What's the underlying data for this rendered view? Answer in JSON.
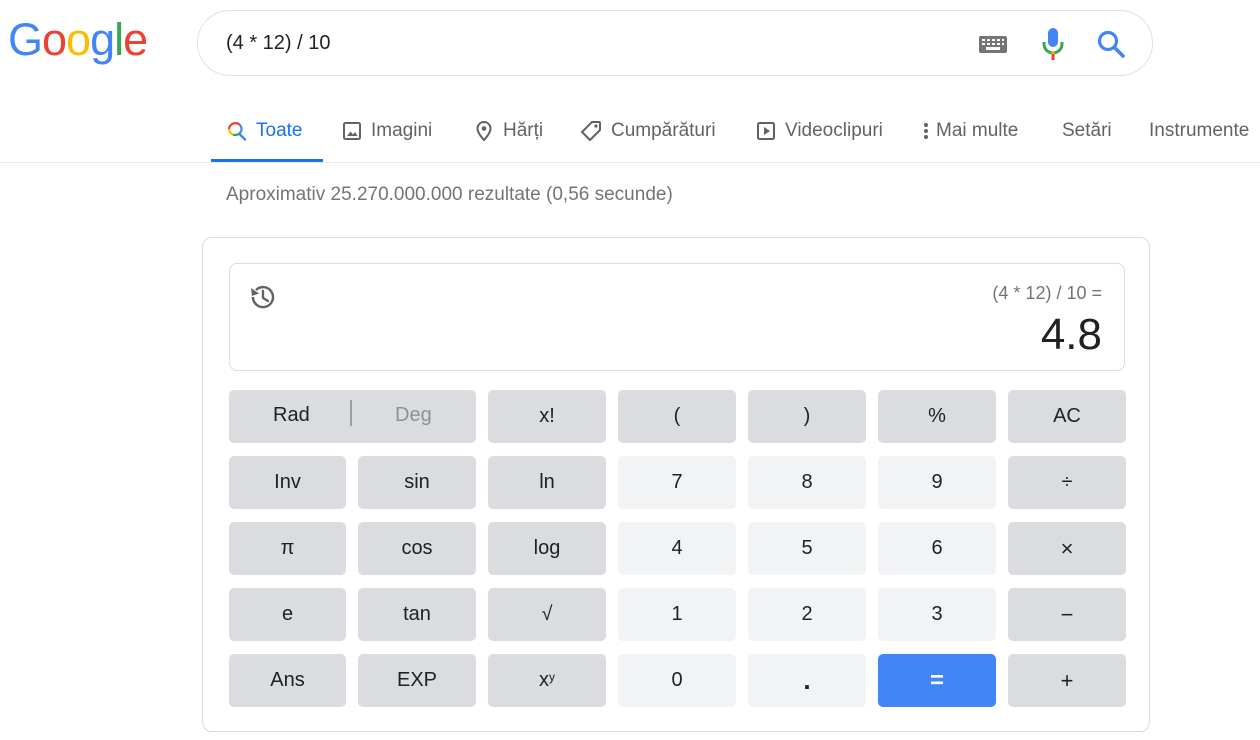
{
  "logo": {
    "letters": [
      {
        "ch": "G",
        "color": "#4285F4"
      },
      {
        "ch": "o",
        "color": "#EA4335"
      },
      {
        "ch": "o",
        "color": "#FBBC05"
      },
      {
        "ch": "g",
        "color": "#4285F4"
      },
      {
        "ch": "l",
        "color": "#34A853"
      },
      {
        "ch": "e",
        "color": "#EA4335"
      }
    ]
  },
  "search": {
    "value": "(4 * 12) / 10",
    "icons": [
      "keyboard-icon",
      "microphone-icon",
      "search-icon"
    ]
  },
  "tabs": [
    {
      "label": "Toate",
      "icon": "search-multicolor-icon",
      "active": true
    },
    {
      "label": "Imagini",
      "icon": "image-icon"
    },
    {
      "label": "Hărți",
      "icon": "map-pin-icon"
    },
    {
      "label": "Cumpărături",
      "icon": "tag-icon"
    },
    {
      "label": "Videoclipuri",
      "icon": "play-icon"
    },
    {
      "label": "Mai multe",
      "icon": "more-vert-icon"
    },
    {
      "label": "Setări"
    },
    {
      "label": "Instrumente"
    }
  ],
  "results_stats": "Aproximativ 25.270.000.000 rezultate (0,56 secunde)",
  "calculator": {
    "expression": "(4 * 12) / 10 =",
    "result": "4.8",
    "rad_label": "Rad",
    "deg_label": "Deg",
    "keys": {
      "fact": "x!",
      "lparen": "(",
      "rparen": ")",
      "percent": "%",
      "ac": "AC",
      "inv": "Inv",
      "sin": "sin",
      "ln": "ln",
      "k7": "7",
      "k8": "8",
      "k9": "9",
      "divide": "÷",
      "pi": "π",
      "cos": "cos",
      "log": "log",
      "k4": "4",
      "k5": "5",
      "k6": "6",
      "multiply": "×",
      "e": "e",
      "tan": "tan",
      "sqrt": "√",
      "k1": "1",
      "k2": "2",
      "k3": "3",
      "minus": "−",
      "ans": "Ans",
      "exp": "EXP",
      "pow_base": "x",
      "pow_sup": "y",
      "k0": "0",
      "dot": ".",
      "equals": "=",
      "plus": "+"
    },
    "colors": {
      "equals_bg": "#4285F4",
      "operator_bg": "#DADCE0",
      "digit_bg": "#F1F3F4"
    }
  }
}
